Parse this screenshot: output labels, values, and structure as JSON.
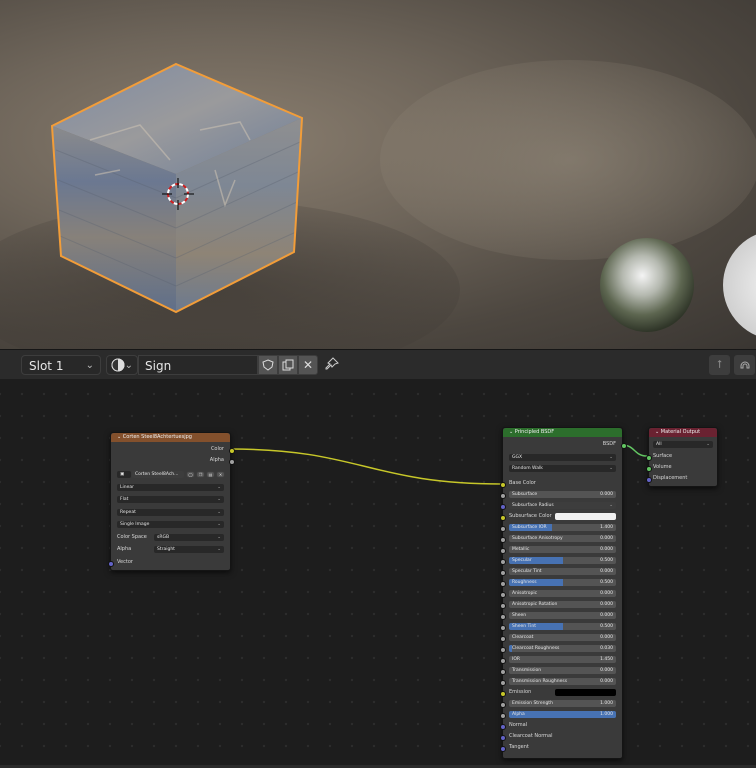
{
  "header": {
    "slot": "Slot 1",
    "material_name": "Sign"
  },
  "image_node": {
    "title": "Corten Steel8Achtertuesjpg",
    "out_color": "Color",
    "out_alpha": "Alpha",
    "image_name": "Corten Steel8Ach...",
    "interpolation": "Linear",
    "projection": "Flat",
    "extension": "Repeat",
    "source": "Single Image",
    "color_space_label": "Color Space",
    "color_space": "sRGB",
    "alpha_label": "Alpha",
    "alpha_mode": "Straight",
    "in_vector": "Vector"
  },
  "bsdf_node": {
    "title": "Principled BSDF",
    "out_bsdf": "BSDF",
    "distribution": "GGX",
    "subsurface_method": "Random Walk",
    "base_color": "Base Color",
    "subsurface": {
      "label": "Subsurface",
      "value": "0.000"
    },
    "subsurface_radius": "Subsurface Radius",
    "subsurface_color": "Subsurface Color",
    "subsurface_ior": {
      "label": "Subsurface IOR",
      "value": "1.400",
      "fill": 0.4
    },
    "subsurface_anisotropy": {
      "label": "Subsurface Anisotropy",
      "value": "0.000"
    },
    "metallic": {
      "label": "Metallic",
      "value": "0.000"
    },
    "specular": {
      "label": "Specular",
      "value": "0.500",
      "fill": 0.5
    },
    "specular_tint": {
      "label": "Specular Tint",
      "value": "0.000"
    },
    "roughness": {
      "label": "Roughness",
      "value": "0.500",
      "fill": 0.5
    },
    "anisotropic": {
      "label": "Anisotropic",
      "value": "0.000"
    },
    "anisotropic_rotation": {
      "label": "Anisotropic Rotation",
      "value": "0.000"
    },
    "sheen": {
      "label": "Sheen",
      "value": "0.000"
    },
    "sheen_tint": {
      "label": "Sheen Tint",
      "value": "0.500",
      "fill": 0.5
    },
    "clearcoat": {
      "label": "Clearcoat",
      "value": "0.000"
    },
    "clearcoat_roughness": {
      "label": "Clearcoat Roughness",
      "value": "0.030",
      "fill": 0.03
    },
    "ior": {
      "label": "IOR",
      "value": "1.450"
    },
    "transmission": {
      "label": "Transmission",
      "value": "0.000"
    },
    "transmission_roughness": {
      "label": "Transmission Roughness",
      "value": "0.000"
    },
    "emission": "Emission",
    "emission_strength": {
      "label": "Emission Strength",
      "value": "1.000"
    },
    "alpha": {
      "label": "Alpha",
      "value": "1.000",
      "fill": 1.0
    },
    "normal": "Normal",
    "clearcoat_normal": "Clearcoat Normal",
    "tangent": "Tangent"
  },
  "output_node": {
    "title": "Material Output",
    "target": "All",
    "surface": "Surface",
    "volume": "Volume",
    "displacement": "Displacement"
  },
  "colors": {
    "selection_outline": "#f29d39",
    "image_header": "#83502c",
    "bsdf_header": "#2c6e2c",
    "output_header": "#6a2231",
    "link_color": "#c7c729",
    "link_shader": "#63c763"
  }
}
